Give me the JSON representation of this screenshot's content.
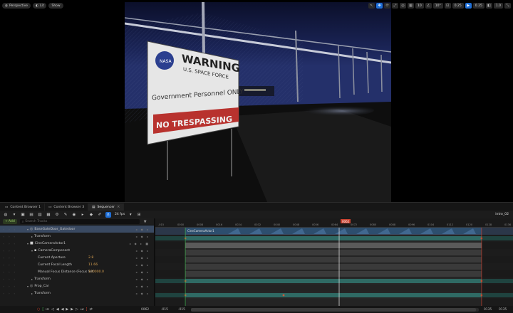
{
  "viewport": {
    "perspective_label": "Perspective",
    "lit_label": "Lit",
    "show_label": "Show",
    "fov_value": "0.25",
    "speed_value": "1.0",
    "sign": {
      "title": "WARNING",
      "subtitle": "U.S. SPACE FORCE",
      "mid_line": "Government Personnel ONLY",
      "bottom_line": "NO TRESPASSING"
    }
  },
  "tabs": [
    {
      "label": "Content Browser 1"
    },
    {
      "label": "Content Browser 3"
    },
    {
      "label": "Sequencer"
    }
  ],
  "toolbar": {
    "fps": "24 fps",
    "sequence_name": "intro_02"
  },
  "tracks": {
    "add_label": "Add",
    "search_placeholder": "Search Tracks",
    "rows": [
      {
        "label": "BaseGateDoor_Gatedoor",
        "indent": 38,
        "kind": "actor"
      },
      {
        "label": "Transform",
        "indent": 44,
        "kind": "sub"
      },
      {
        "label": "CineCameraActor1",
        "indent": 38,
        "kind": "camera"
      },
      {
        "label": "CameraComponent",
        "indent": 44,
        "kind": "comp"
      },
      {
        "label": "Current Aperture",
        "indent": 53,
        "kind": "prop",
        "value": "2.8"
      },
      {
        "label": "Current Focal Length",
        "indent": 53,
        "kind": "prop",
        "value": "11.66"
      },
      {
        "label": "Manual Focus Distance (Focus Set",
        "indent": 53,
        "kind": "prop",
        "value": "100000.0"
      },
      {
        "label": "Transform",
        "indent": 44,
        "kind": "sub"
      },
      {
        "label": "Prop_Car",
        "indent": 38,
        "kind": "actor"
      },
      {
        "label": "Transform",
        "indent": 44,
        "kind": "sub"
      }
    ]
  },
  "timeline": {
    "playhead_frame": "0062",
    "ruler_labels": [
      "-015",
      "0000",
      "0008",
      "0016",
      "0024",
      "0032",
      "0040",
      "0048",
      "0056",
      "0064",
      "0072",
      "0080",
      "0088",
      "0096",
      "0104",
      "0112",
      "0120",
      "0128",
      "0136"
    ],
    "camera_section_label": "CineCameraActor1"
  },
  "bottom": {
    "current_frame": "0062",
    "range_start_a": "-015",
    "range_start_b": "-015",
    "range_end_a": "0135",
    "range_end_b": "0135"
  },
  "colors": {
    "accent_blue": "#1f6fd6",
    "playhead_red": "#c8412f",
    "track_selected": "#3a4a62",
    "section_teal": "#2a5a55"
  }
}
